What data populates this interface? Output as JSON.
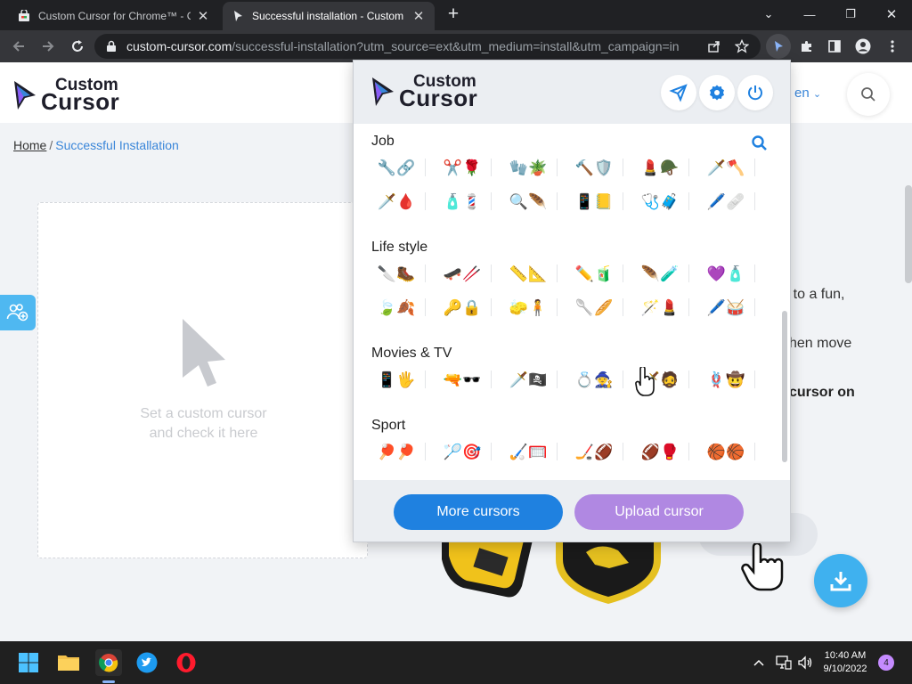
{
  "browser": {
    "tabs": [
      {
        "title": "Custom Cursor for Chrome™ - Chrome Web Store",
        "active": false
      },
      {
        "title": "Successful installation - Custom Cursor",
        "active": true
      }
    ],
    "url_host": "custom-cursor.com",
    "url_path": "/successful-installation?utm_source=ext&utm_medium=install&utm_campaign=in..."
  },
  "site": {
    "logo_line1": "Custom",
    "logo_line2": "Cursor",
    "lang": "en",
    "breadcrumb_home": "Home",
    "breadcrumb_sep": "/",
    "breadcrumb_current": "Successful Installation",
    "cursor_box_hint_1": "Set a custom cursor",
    "cursor_box_hint_2": "and check it here",
    "partial_text_1": "er to a fun,",
    "partial_text_2": "hen move",
    "partial_text_3": "cursor on"
  },
  "popup": {
    "logo_line1": "Custom",
    "logo_line2": "Cursor",
    "categories": [
      {
        "title": "Job",
        "rows": [
          [
            "🔧🔗",
            "✂️🌹",
            "🧤🪴",
            "🔨🛡️",
            "💄🪖",
            "🗡️🪓"
          ],
          [
            "🗡️🩸",
            "🧴💈",
            "🔍🪶",
            "📱📒",
            "🩺🧳",
            "🖊️🩹"
          ]
        ]
      },
      {
        "title": "Life style",
        "rows": [
          [
            "🔪🥾",
            "🛹🥢",
            "📏📐",
            "✏️🧃",
            "🪶🧪",
            "💜🧴"
          ],
          [
            "🍃🍂",
            "🔑🔒",
            "🧽🧍",
            "🥄🥖",
            "🪄💄",
            "🖊️🥁"
          ]
        ]
      },
      {
        "title": "Movies & TV",
        "rows": [
          [
            "📱🖐️",
            "🔫🕶️",
            "🗡️🏴‍☠️",
            "💍🧙",
            "🗡️🧔",
            "🪢🤠"
          ]
        ]
      },
      {
        "title": "Sport",
        "rows": [
          [
            "🏓🏓",
            "🏸🎯",
            "🏑🥅",
            "🏒🏈",
            "🏈🥊",
            "🏀🏀"
          ]
        ]
      }
    ],
    "more_button": "More cursors",
    "upload_button": "Upload cursor"
  },
  "taskbar": {
    "time": "10:40 AM",
    "date": "9/10/2022",
    "notifications": "4"
  },
  "colors": {
    "accent_blue": "#1f81e0",
    "accent_purple": "#b088e2",
    "link_blue": "#3a86d9",
    "download_blue": "#3fb1ef"
  }
}
